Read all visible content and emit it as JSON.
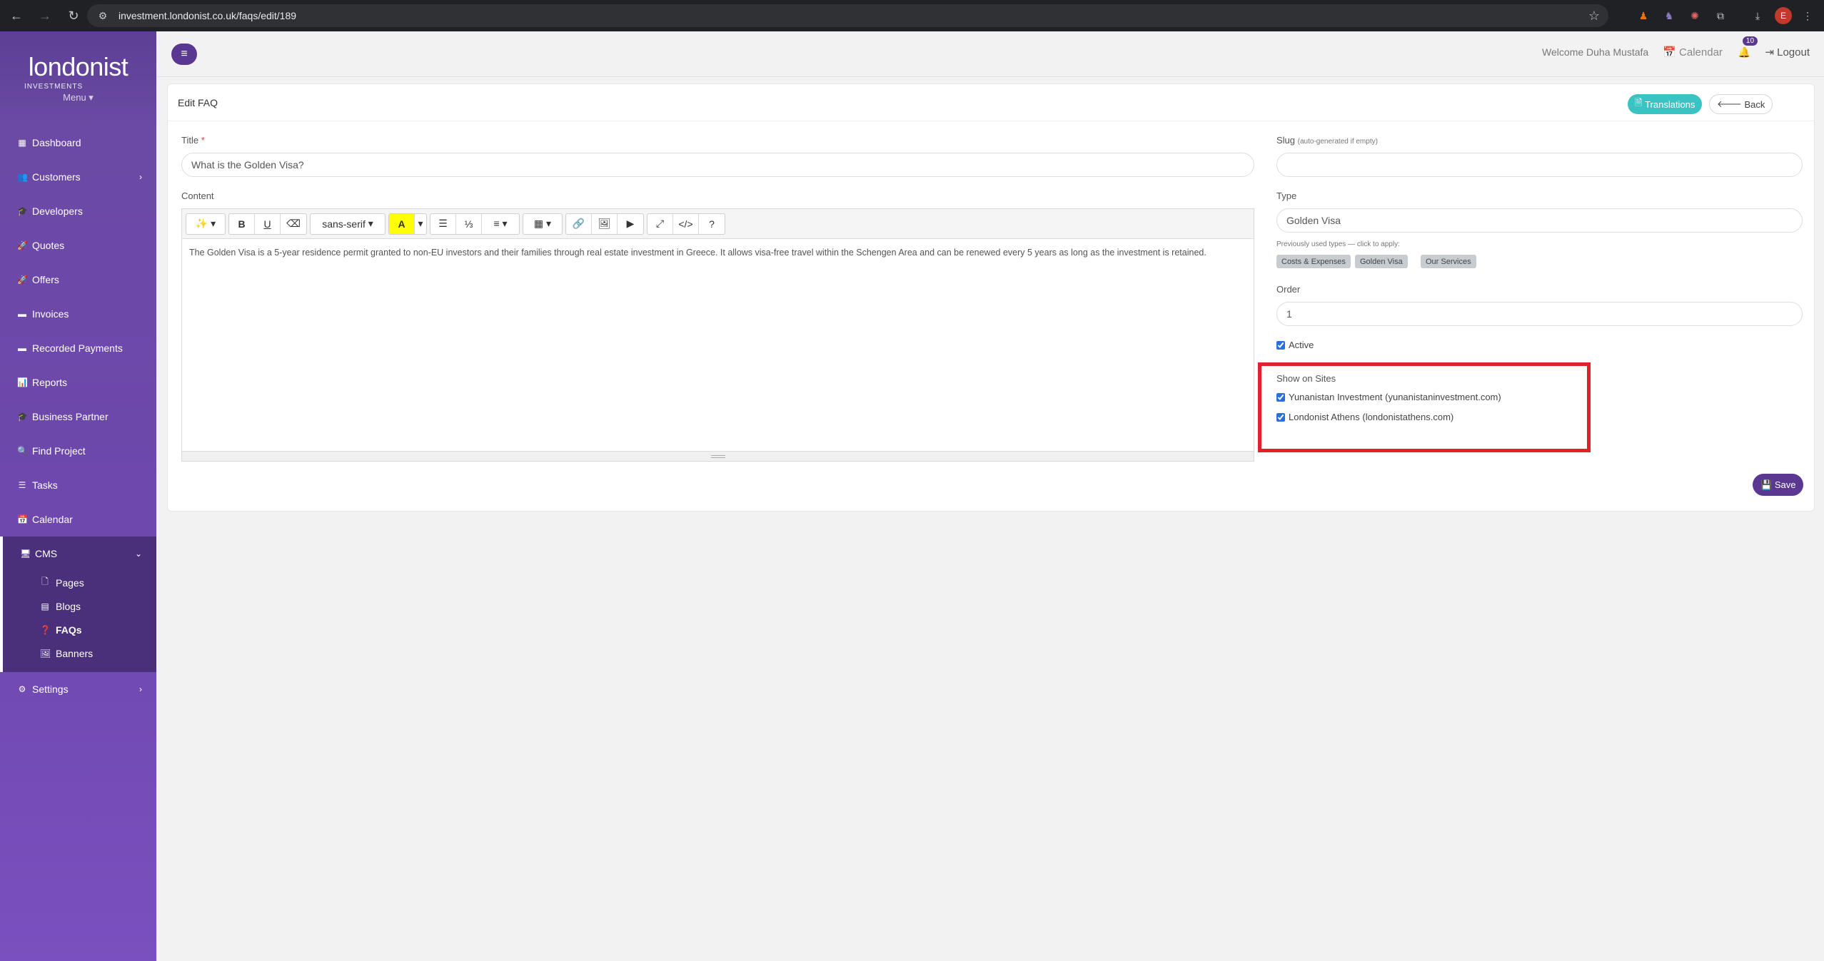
{
  "browser": {
    "url": "investment.londonist.co.uk/faqs/edit/189",
    "profile_initial": "E"
  },
  "sidebar": {
    "logo": "londonist",
    "logo_sub": "INVESTMENTS",
    "menu_label": "Menu ▾",
    "items": [
      {
        "label": "Dashboard",
        "icon": "dashboard-icon",
        "glyph": "▦"
      },
      {
        "label": "Customers",
        "icon": "users-icon",
        "glyph": "👥"
      },
      {
        "label": "Developers",
        "icon": "graduation-cap-icon",
        "glyph": "🎓"
      },
      {
        "label": "Quotes",
        "icon": "rocket-icon",
        "glyph": "🚀"
      },
      {
        "label": "Offers",
        "icon": "rocket-icon",
        "glyph": "🚀"
      },
      {
        "label": "Invoices",
        "icon": "credit-card-icon",
        "glyph": "▬"
      },
      {
        "label": "Recorded Payments",
        "icon": "credit-card-icon",
        "glyph": "▬"
      },
      {
        "label": "Reports",
        "icon": "bar-chart-icon",
        "glyph": "📊"
      },
      {
        "label": "Business Partner",
        "icon": "graduation-cap-icon",
        "glyph": "🎓"
      },
      {
        "label": "Find Project",
        "icon": "search-icon",
        "glyph": "🔍"
      },
      {
        "label": "Tasks",
        "icon": "list-icon",
        "glyph": "☰"
      },
      {
        "label": "Calendar",
        "icon": "calendar-icon",
        "glyph": "📅"
      }
    ],
    "cms": {
      "label": "CMS",
      "items": [
        {
          "label": "Pages",
          "glyph": "🗋"
        },
        {
          "label": "Blogs",
          "glyph": "▤"
        },
        {
          "label": "FAQs",
          "glyph": "❓"
        },
        {
          "label": "Banners",
          "glyph": "🖼"
        }
      ]
    },
    "settings": "Settings"
  },
  "topbar": {
    "welcome": "Welcome Duha Mustafa",
    "calendar": "Calendar",
    "notifications": "10",
    "logout": "Logout"
  },
  "card": {
    "title": "Edit FAQ",
    "translations": "Translations",
    "back": "Back",
    "save": "Save"
  },
  "form": {
    "title_label": "Title",
    "title_required": "*",
    "title_value": "What is the Golden Visa?",
    "content_label": "Content",
    "content_text": "The Golden Visa is a 5-year residence permit granted to non-EU investors and their families through real estate investment in Greece. It allows visa-free travel within the Schengen Area and can be renewed every 5 years as long as the investment is retained.",
    "slug_label": "Slug",
    "slug_hint": "(auto-generated if empty)",
    "slug_value": "",
    "type_label": "Type",
    "type_value": "Golden Visa",
    "type_help": "Previously used types — click to apply:",
    "type_tags": [
      "Costs & Expenses",
      "Golden Visa",
      "Our Services"
    ],
    "order_label": "Order",
    "order_value": "1",
    "active_label": "Active",
    "sites_label": "Show on Sites",
    "site1": "Yunanistan Investment (yunanistaninvestment.com)",
    "site2": "Londonist Athens (londonistathens.com)"
  },
  "editor": {
    "font_name": "sans-serif"
  },
  "colors": {
    "sidebar": "#6a4aa4",
    "accent": "#5a3791",
    "translations_button": "#3ac3c3",
    "highlight": "#e0202a"
  }
}
